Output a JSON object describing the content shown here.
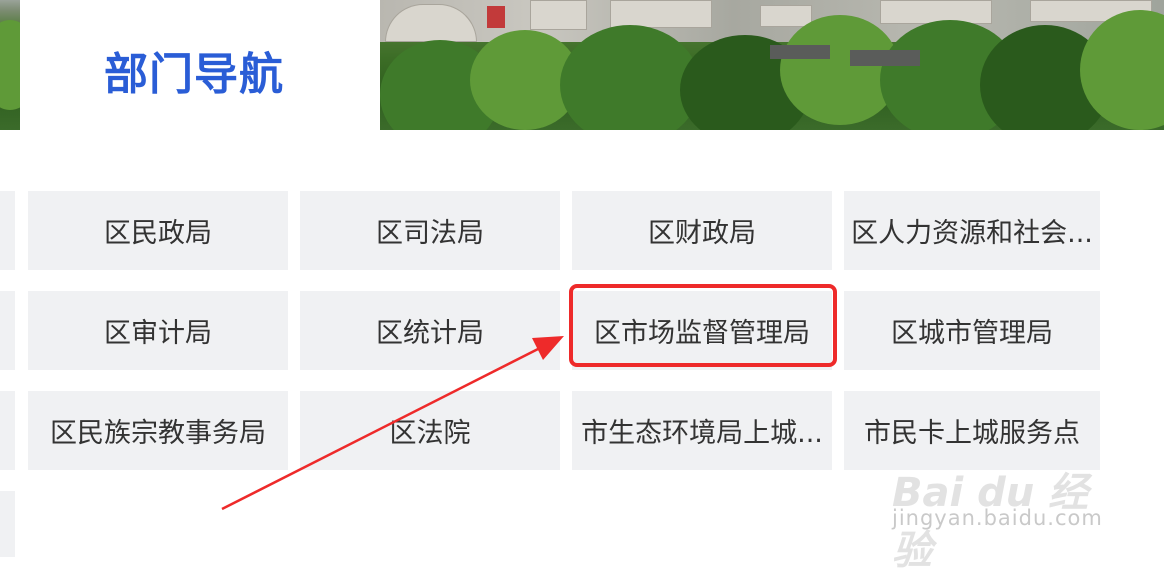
{
  "header": {
    "title": "部门导航"
  },
  "departments": [
    [
      "区民政局",
      "区司法局",
      "区财政局",
      "区人力资源和社会..."
    ],
    [
      "区审计局",
      "区统计局",
      "区市场监督管理局",
      "区城市管理局"
    ],
    [
      "区民族宗教事务局",
      "区法院",
      "市生态环境局上城...",
      "市民卡上城服务点"
    ]
  ],
  "colors": {
    "title": "#2a5dd6",
    "highlight": "#ee2a2a",
    "cell_bg": "#f0f1f3"
  },
  "watermark": {
    "logo": "Bai du 经验",
    "sub": "jingyan.baidu.com"
  }
}
